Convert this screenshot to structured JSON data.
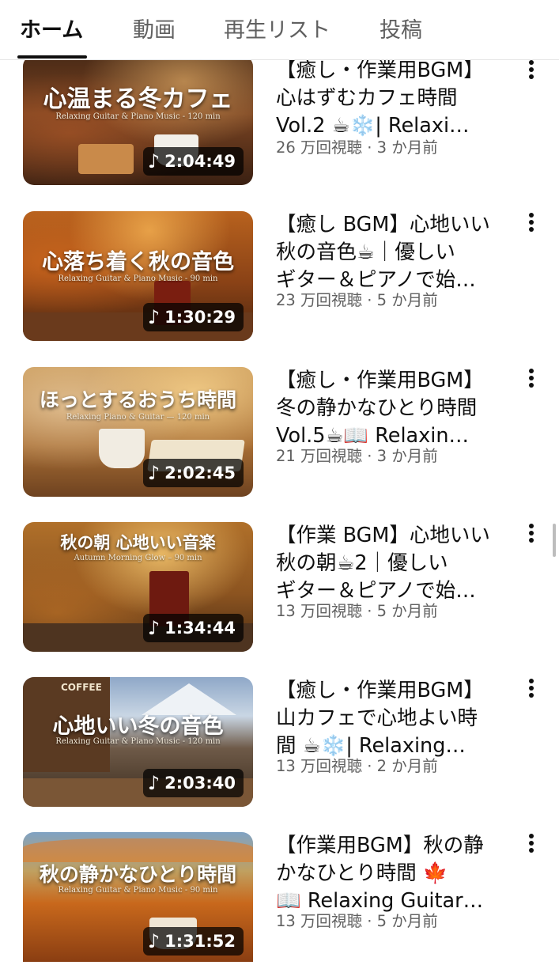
{
  "tabs": [
    {
      "label": "ホーム",
      "active": true
    },
    {
      "label": "動画",
      "active": false
    },
    {
      "label": "再生リスト",
      "active": false
    },
    {
      "label": "投稿",
      "active": false
    }
  ],
  "videos": [
    {
      "thumb_title": "心温まる冬カフェ",
      "thumb_sub": "Relaxing Guitar & Piano Music - 120 min",
      "duration": "2:04:49",
      "title_lines": [
        "【癒し・作業用BGM】",
        "心はずむカフェ時間",
        "Vol.2 ☕❄️| Relaxi…"
      ],
      "meta": "26 万回視聴 · 3 か月前"
    },
    {
      "thumb_title": "心落ち着く秋の音色",
      "thumb_sub": "Relaxing Guitar & Piano Music - 90 min",
      "duration": "1:30:29",
      "title_lines": [
        "【癒し BGM】心地いい",
        "秋の音色☕｜優しい",
        "ギター＆ピアノで始…"
      ],
      "meta": "23 万回視聴 · 5 か月前"
    },
    {
      "thumb_title": "ほっとするおうち時間",
      "thumb_sub": "Relaxing Piano & Guitar — 120 min",
      "duration": "2:02:45",
      "title_lines": [
        "【癒し・作業用BGM】",
        "冬の静かなひとり時間",
        "Vol.5☕📖 Relaxin…"
      ],
      "meta": "21 万回視聴 · 3 か月前"
    },
    {
      "thumb_title": "秋の朝 心地いい音楽",
      "thumb_sub": "Autumn Morning Glow – 90 min",
      "duration": "1:34:44",
      "title_lines": [
        "【作業 BGM】心地いい",
        "秋の朝☕2｜優しい",
        "ギター＆ピアノで始…"
      ],
      "meta": "13 万回視聴 · 5 か月前"
    },
    {
      "thumb_title": "心地いい冬の音色",
      "thumb_sub": "Relaxing Guitar & Piano Music - 120 min",
      "thumb_sign": "COFFEE",
      "duration": "2:03:40",
      "title_lines": [
        "【癒し・作業用BGM】",
        "山カフェで心地よい時",
        "間 ☕❄️| Relaxing…"
      ],
      "meta": "13 万回視聴 · 2 か月前"
    },
    {
      "thumb_title": "秋の静かなひとり時間",
      "thumb_sub": "Relaxing Guitar & Piano Music - 90 min",
      "duration": "1:31:52",
      "title_lines": [
        "【作業用BGM】秋の静",
        "かなひとり時間 🍁",
        "📖 Relaxing Guitar…"
      ],
      "meta": "13 万回視聴 · 5 か月前"
    }
  ],
  "icons": {
    "more": "more-vert-icon",
    "music": "music-note-icon"
  },
  "colors": {
    "text_primary": "#0f0f0f",
    "text_secondary": "#606060",
    "tab_indicator": "#0f0f0f"
  }
}
